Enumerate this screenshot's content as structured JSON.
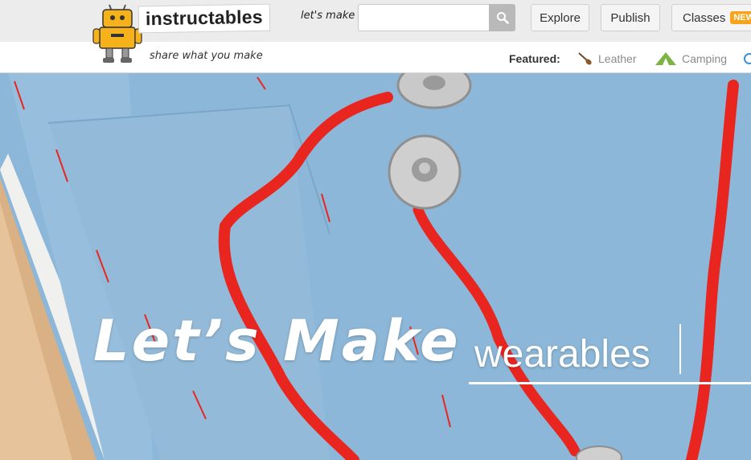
{
  "header": {
    "logo_text": "instructables",
    "tagline": "share what you make",
    "search": {
      "label": "let's make",
      "value": "",
      "placeholder": ""
    },
    "nav": {
      "explore": "Explore",
      "publish": "Publish",
      "classes": "Classes",
      "classes_badge": "NEW!"
    }
  },
  "featured": {
    "label": "Featured:",
    "items": [
      {
        "label": "Leather",
        "icon": "leather-tool-icon"
      },
      {
        "label": "Camping",
        "icon": "tent-icon"
      },
      {
        "label": "",
        "icon": "partial-icon"
      }
    ]
  },
  "hero": {
    "title": "Let’s Make",
    "rotating_word": "wearables"
  },
  "colors": {
    "accent": "#f9a31b",
    "felt": "#8cb7d8",
    "thread": "#e8261f",
    "camping_green": "#7cb342"
  }
}
